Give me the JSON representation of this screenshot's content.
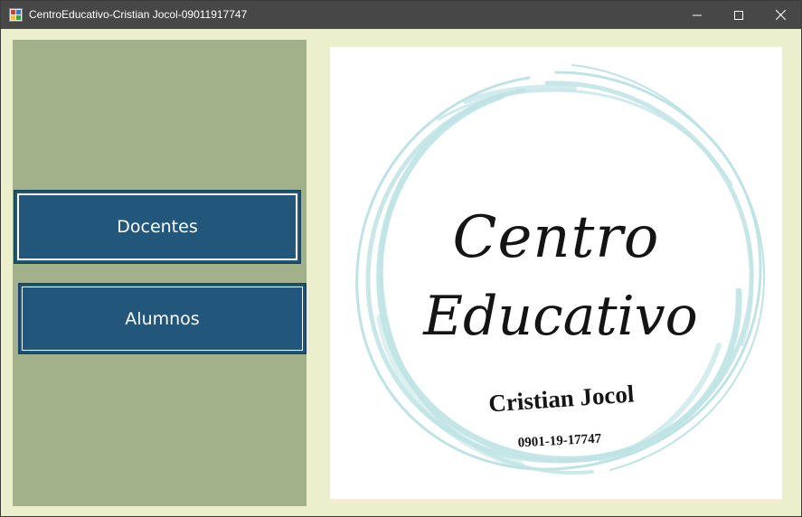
{
  "window": {
    "title": "CentroEducativo-Cristian Jocol-09011917747",
    "minimize_icon": "minimize-icon",
    "maximize_icon": "maximize-icon",
    "close_icon": "close-icon"
  },
  "sidebar": {
    "buttons": [
      {
        "label": "Docentes"
      },
      {
        "label": "Alumnos"
      }
    ]
  },
  "logo": {
    "line1": "Centro",
    "line2": "Educativo",
    "name": "Cristian Jocol",
    "code": "0901-19-17747",
    "ring_color": "#bfe3e4"
  },
  "colors": {
    "titlebar": "#474747",
    "window_bg": "#ecefcb",
    "sidebar_bg": "#a2b18a",
    "button_bg": "#22567a",
    "button_text": "#ffffff"
  }
}
